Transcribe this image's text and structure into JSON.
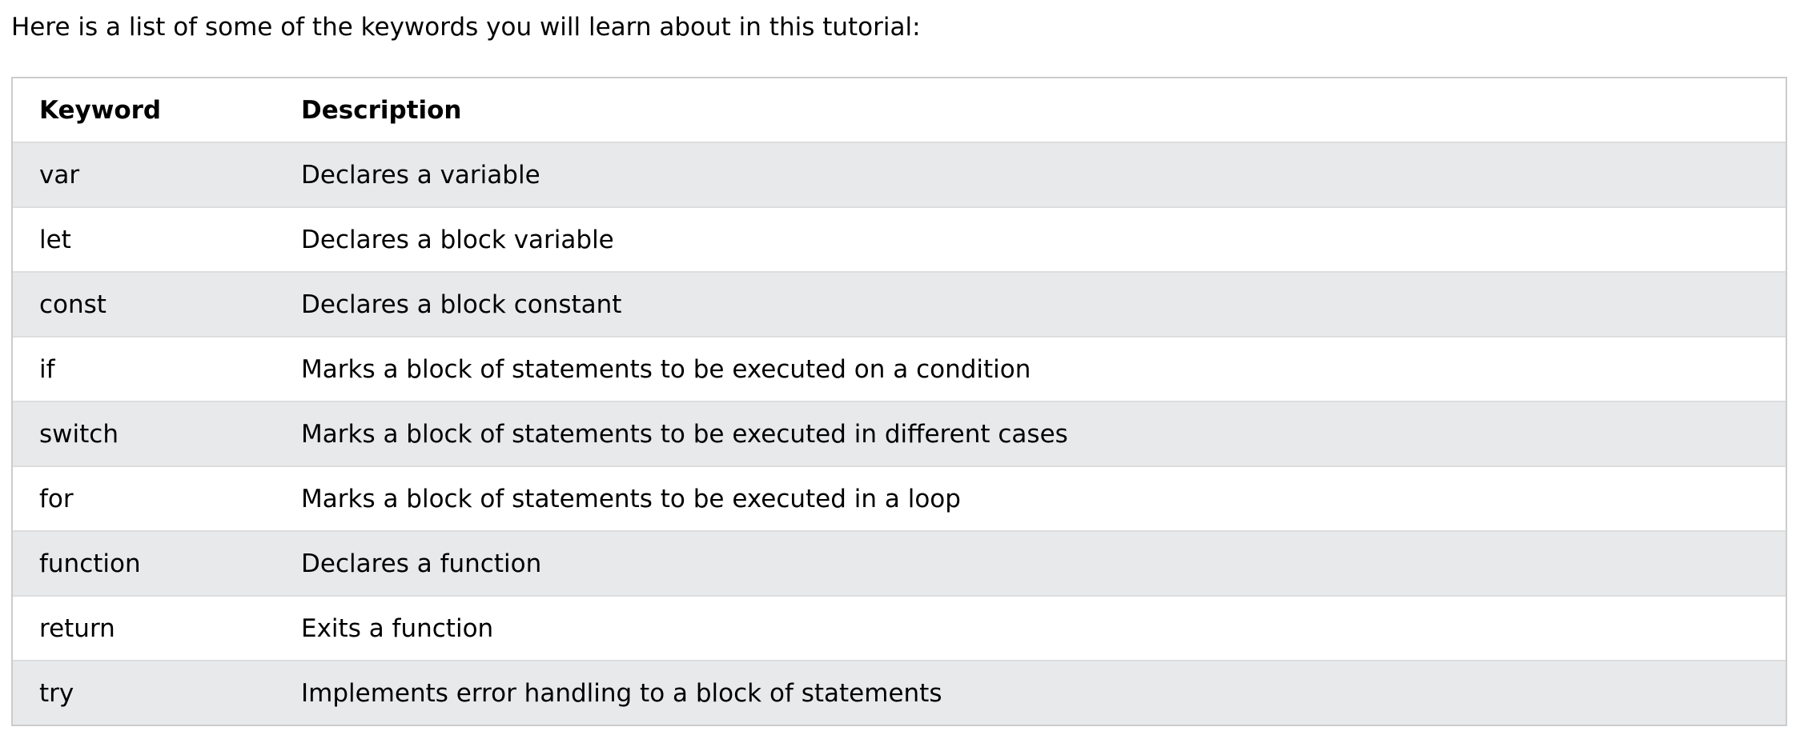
{
  "intro_text": "Here is a list of some of the keywords you will learn about in this tutorial:",
  "table": {
    "headers": {
      "keyword": "Keyword",
      "description": "Description"
    },
    "rows": [
      {
        "keyword": "var",
        "description": "Declares a variable"
      },
      {
        "keyword": "let",
        "description": "Declares a block variable"
      },
      {
        "keyword": "const",
        "description": "Declares a block constant"
      },
      {
        "keyword": "if",
        "description": "Marks a block of statements to be executed on a condition"
      },
      {
        "keyword": "switch",
        "description": "Marks a block of statements to be executed in different cases"
      },
      {
        "keyword": "for",
        "description": "Marks a block of statements to be executed in a loop"
      },
      {
        "keyword": "function",
        "description": "Declares a function"
      },
      {
        "keyword": "return",
        "description": "Exits a function"
      },
      {
        "keyword": "try",
        "description": "Implements error handling to a block of statements"
      }
    ]
  },
  "colors": {
    "row_stripe": "#e7e9eb",
    "row_plain": "#ffffff",
    "border": "#cccccc",
    "divider": "#dddddd"
  }
}
